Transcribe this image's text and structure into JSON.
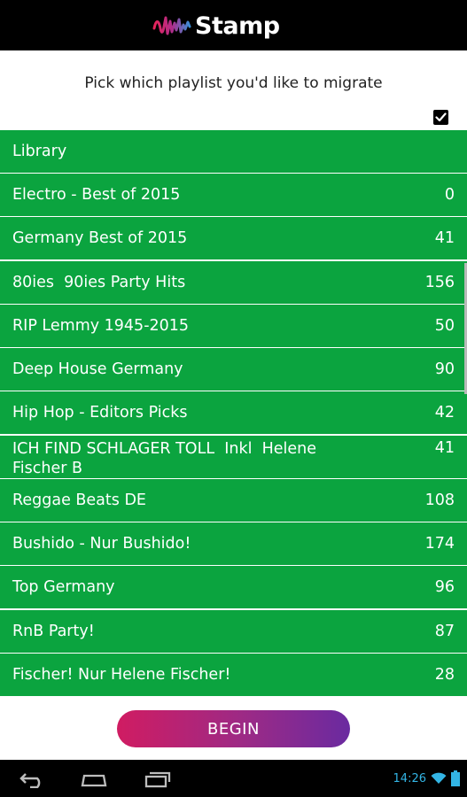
{
  "app": {
    "name": "Stamp"
  },
  "prompt": "Pick which playlist you'd like to migrate",
  "select_all": {
    "checked": true
  },
  "playlists": [
    {
      "name": "Library",
      "count": ""
    },
    {
      "name": "Electro - Best of 2015",
      "count": "0"
    },
    {
      "name": "Germany Best of 2015",
      "count": "41"
    },
    {
      "name": "80ies  90ies Party Hits",
      "count": "156"
    },
    {
      "name": "RIP Lemmy 1945-2015",
      "count": "50"
    },
    {
      "name": "Deep House Germany",
      "count": "90"
    },
    {
      "name": "Hip Hop - Editors Picks",
      "count": "42"
    },
    {
      "name": "ICH FIND SCHLAGER TOLL  Inkl  Helene Fischer B",
      "count": "41"
    },
    {
      "name": "Reggae Beats DE",
      "count": "108"
    },
    {
      "name": "Bushido - Nur Bushido!",
      "count": "174"
    },
    {
      "name": "Top Germany",
      "count": "96"
    },
    {
      "name": "RnB Party!",
      "count": "87"
    },
    {
      "name": "Fischer! Nur Helene Fischer!",
      "count": "28"
    }
  ],
  "begin_button": "BEGIN",
  "status_bar": {
    "time": "14:26"
  },
  "colors": {
    "row_green": "#0ba43f",
    "accent_pink": "#d01c62",
    "accent_purple": "#6a2aa0",
    "clock_blue": "#33b5e5"
  }
}
